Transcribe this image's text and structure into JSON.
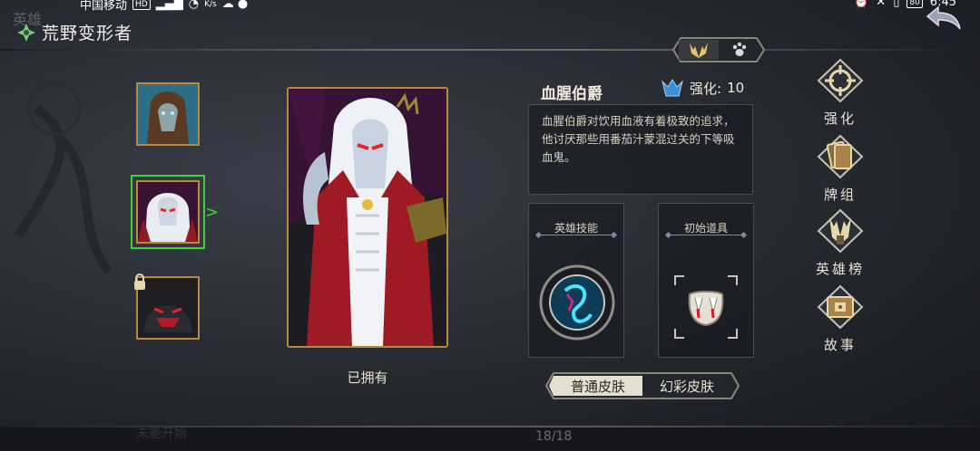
{
  "status_bar": {
    "carrier": "中国移动",
    "hd": "HD",
    "net_speed": "K/s",
    "battery": "80",
    "time": "6:45"
  },
  "header": {
    "faded_text": "英雄",
    "title": "荒野变形者"
  },
  "hero": {
    "name": "血腥伯爵",
    "enhance_label": "强化:",
    "enhance_level": "10",
    "description": "血腥伯爵对饮用血液有着极致的追求，他讨厌那些用番茄汁蒙混过关的下等吸血鬼。",
    "owned_label": "已拥有"
  },
  "panels": {
    "skill_title": "英雄技能",
    "item_title": "初始道具"
  },
  "skins": {
    "normal": "普通皮肤",
    "rainbow": "幻彩皮肤",
    "selected": "普通皮肤"
  },
  "side_menu": [
    {
      "label": "强化",
      "icon": "crosshair-icon"
    },
    {
      "label": "牌组",
      "icon": "card-deck-icon"
    },
    {
      "label": "英雄榜",
      "icon": "leaderboard-icon"
    },
    {
      "label": "故事",
      "icon": "story-book-icon"
    }
  ],
  "hero_list": [
    {
      "name": "hooded-hero",
      "locked": false,
      "selected": false
    },
    {
      "name": "blood-count",
      "locked": false,
      "selected": true
    },
    {
      "name": "shadow-beast",
      "locked": true,
      "selected": false
    }
  ],
  "bottom": {
    "faded_text": "未能开始",
    "page_counter": "18/18"
  },
  "colors": {
    "accent_gold": "#b88a3e",
    "select_green": "#3fd13a",
    "panel_border": "#4a4e58"
  }
}
